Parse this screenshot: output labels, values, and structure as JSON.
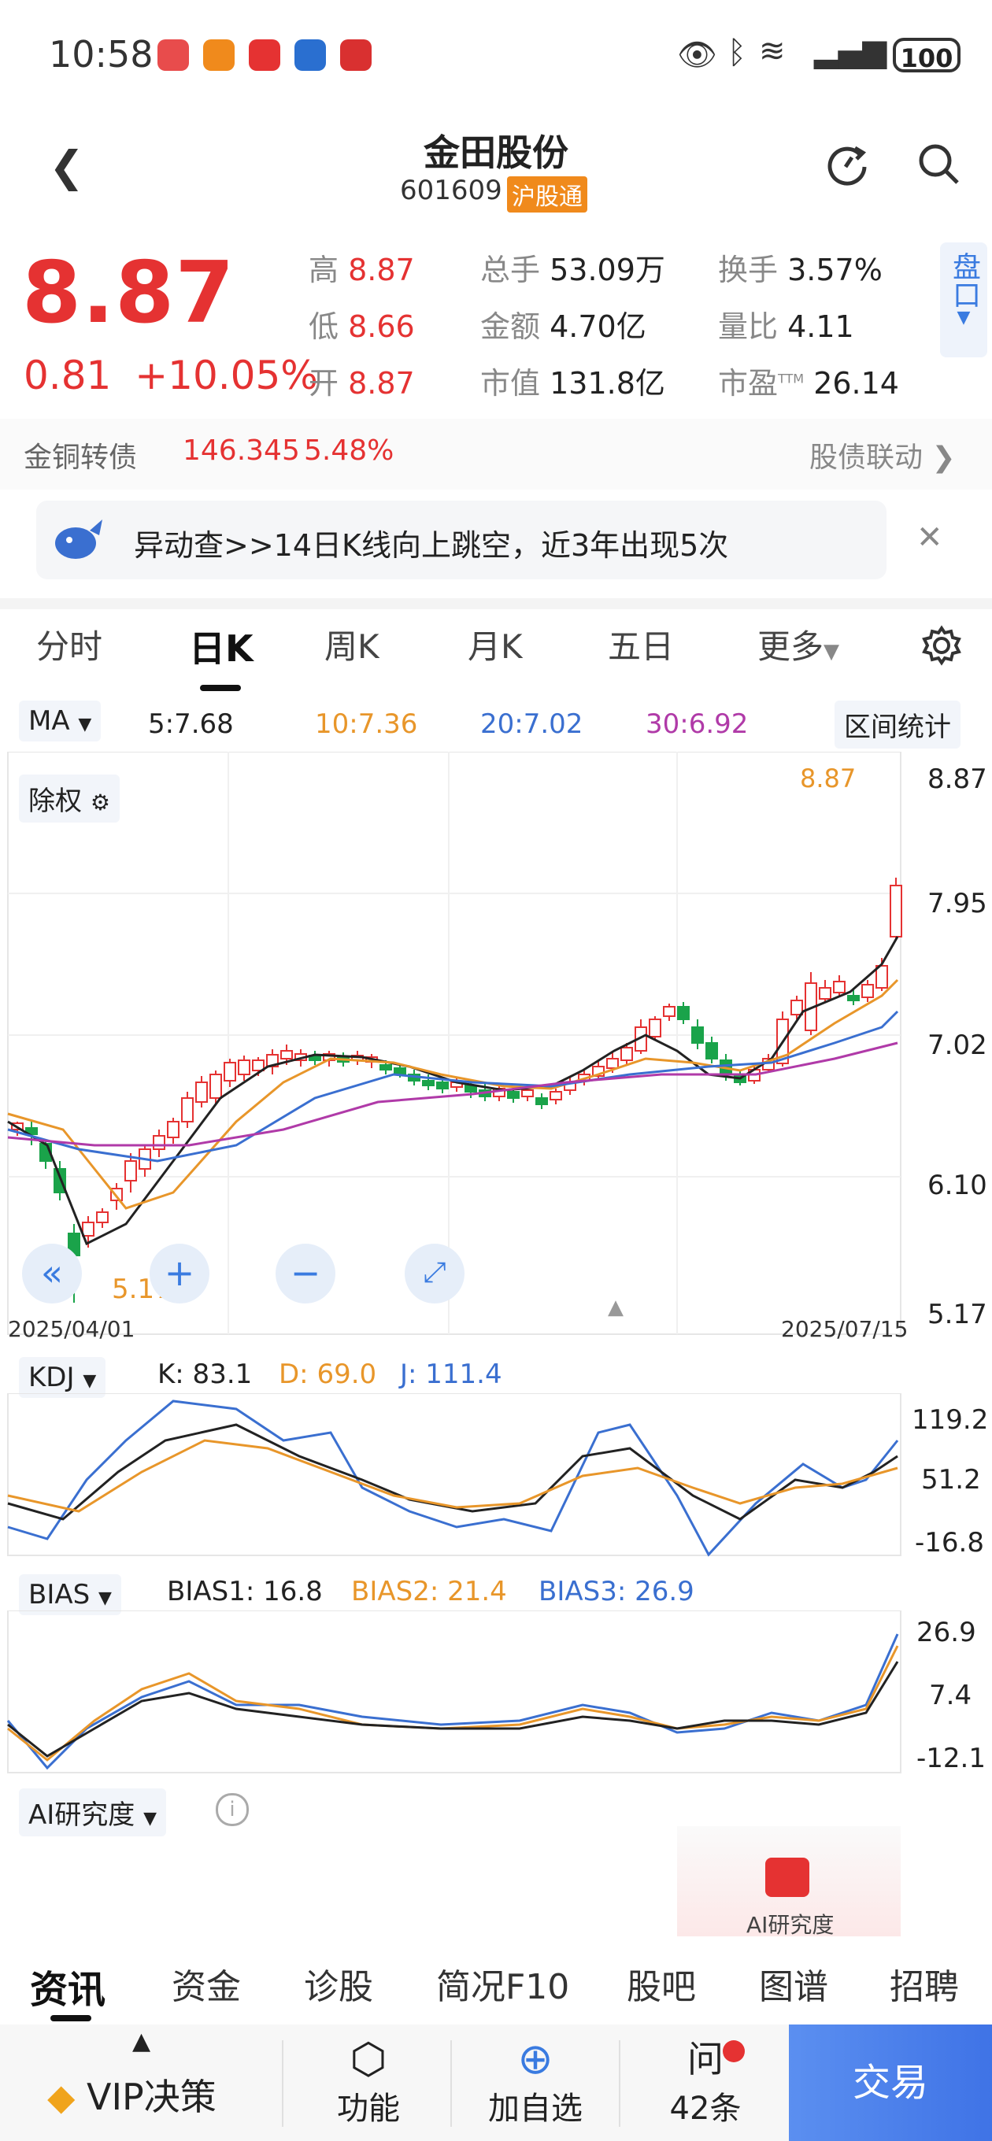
{
  "status": {
    "time": "10:58",
    "battery": "100"
  },
  "header": {
    "title": "金田股份",
    "code": "601609",
    "tag": "沪股通"
  },
  "quote": {
    "price": "8.87",
    "change": "0.81",
    "change_pct": "+10.05%",
    "high_label": "高",
    "high": "8.87",
    "low_label": "低",
    "low": "8.66",
    "open_label": "开",
    "open": "8.87",
    "volume_label": "总手",
    "volume": "53.09万",
    "amount_label": "金额",
    "amount": "4.70亿",
    "mcap_label": "市值",
    "mcap": "131.8亿",
    "turnover_label": "换手",
    "turnover": "3.57%",
    "vol_ratio_label": "量比",
    "vol_ratio": "4.11",
    "pe_label": "市盈",
    "pe_sup": "TTM",
    "pe": "26.14",
    "pankou": "盘口"
  },
  "bond": {
    "name": "金铜转债",
    "price": "146.345",
    "pct": "5.48%",
    "link": "股债联动"
  },
  "notice": {
    "text": "异动查>>14日K线向上跳空，近3年出现5次"
  },
  "tabs": [
    "分时",
    "日K",
    "周K",
    "月K",
    "五日",
    "更多"
  ],
  "ma": {
    "label": "MA",
    "ma5": "5:7.68",
    "ma10": "10:7.36",
    "ma20": "20:7.02",
    "ma30": "30:6.92",
    "range_stat": "区间统计",
    "chuquan": "除权"
  },
  "kchart": {
    "yticks": [
      "8.87",
      "7.95",
      "7.02",
      "6.10",
      "5.17"
    ],
    "max_label": "8.87",
    "min_label": "5.17",
    "date_start": "2025/04/01",
    "date_end": "2025/07/15"
  },
  "kdj": {
    "label": "KDJ",
    "k": "K: 83.1",
    "d": "D: 69.0",
    "j": "J: 111.4",
    "yticks": [
      "119.2",
      "51.2",
      "-16.8"
    ]
  },
  "bias": {
    "label": "BIAS",
    "b1": "BIAS1: 16.8",
    "b2": "BIAS2: 21.4",
    "b3": "BIAS3: 26.9",
    "yticks": [
      "26.9",
      "7.4",
      "-12.1"
    ]
  },
  "ai": {
    "label": "AI研究度",
    "lock_text": "AI研究度"
  },
  "bottom_tabs": [
    "资讯",
    "资金",
    "诊股",
    "简况F10",
    "股吧",
    "图谱",
    "招聘"
  ],
  "bottombar": {
    "vip": "VIP决策",
    "func": "功能",
    "add": "加自选",
    "ask": "42条",
    "trade": "交易"
  },
  "colors": {
    "up": "#e53232",
    "down": "#1aa34a",
    "ma5": "#222222",
    "ma10": "#e8962a",
    "ma20": "#3a6fd0",
    "ma30": "#b03aa8",
    "accent": "#3a7be0"
  }
}
